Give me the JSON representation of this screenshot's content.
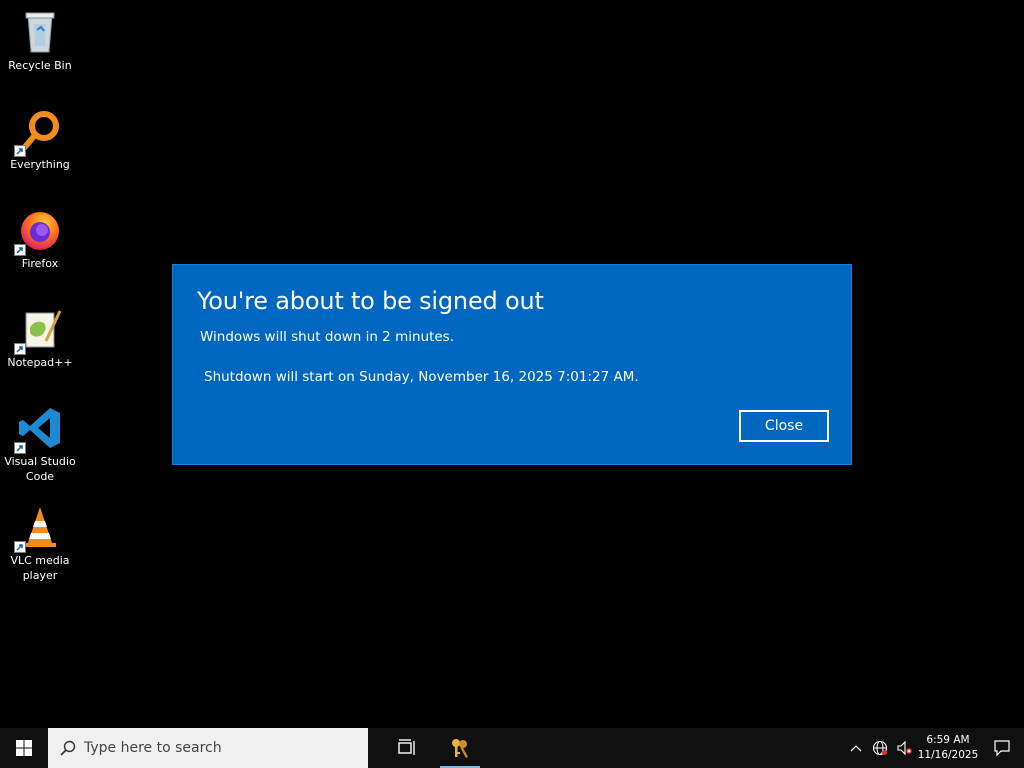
{
  "desktop": {
    "icons": [
      {
        "label": "Recycle Bin",
        "icon": "recycle-bin-icon"
      },
      {
        "label": "Everything",
        "icon": "everything-icon"
      },
      {
        "label": "Firefox",
        "icon": "firefox-icon"
      },
      {
        "label": "Notepad++",
        "icon": "notepadpp-icon"
      },
      {
        "label": "Visual Studio\nCode",
        "icon": "vscode-icon"
      },
      {
        "label": "VLC media\nplayer",
        "icon": "vlc-icon"
      }
    ]
  },
  "dialog": {
    "title": "You're about to be signed out",
    "message": "Windows will shut down in 2 minutes.",
    "detail": "Shutdown will start on Sunday, November 16, 2025 7:01:27 AM.",
    "close_label": "Close",
    "background_color": "#0067c0"
  },
  "taskbar": {
    "search_placeholder": "Type here to search",
    "pinned": [
      {
        "name": "task-view",
        "icon": "task-view-icon"
      },
      {
        "name": "app",
        "icon": "keys-icon",
        "active": true
      }
    ],
    "tray": {
      "time": "6:59 AM",
      "date": "11/16/2025",
      "icons": [
        "chevron-up-icon",
        "network-icon",
        "volume-muted-icon"
      ]
    }
  }
}
